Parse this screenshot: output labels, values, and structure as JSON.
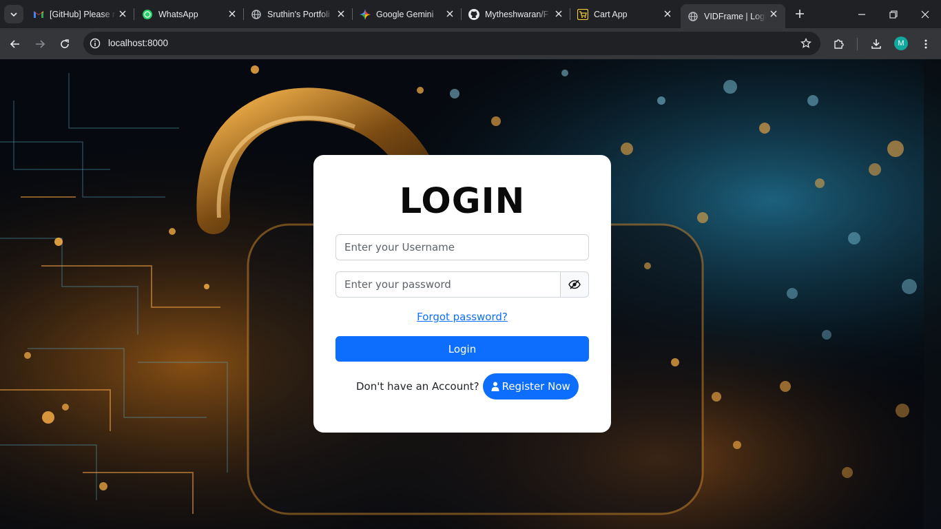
{
  "browser": {
    "tabs": [
      {
        "title": "[GitHub] Please r",
        "icon": "gmail-icon",
        "active": false
      },
      {
        "title": "WhatsApp",
        "icon": "whatsapp-icon",
        "active": false
      },
      {
        "title": "Sruthin's Portfoli",
        "icon": "globe-icon",
        "active": false
      },
      {
        "title": "Google Gemini",
        "icon": "gemini-icon",
        "active": false
      },
      {
        "title": "Mytheshwaran/F",
        "icon": "github-icon",
        "active": false
      },
      {
        "title": "Cart App",
        "icon": "cart-app-icon",
        "active": false
      },
      {
        "title": "VIDFrame | Login",
        "icon": "globe-icon",
        "active": true
      }
    ],
    "url": "localhost:8000",
    "profile_initial": "M",
    "accent": "#11a89d"
  },
  "login": {
    "title": "LOGIN",
    "username_placeholder": "Enter your Username",
    "username_value": "",
    "password_placeholder": "Enter your password",
    "password_value": "",
    "forgot_label": "Forgot password?",
    "login_label": "Login",
    "register_prompt": "Don't have an Account?",
    "register_label": "Register Now",
    "primary_color": "#0d6efd"
  }
}
